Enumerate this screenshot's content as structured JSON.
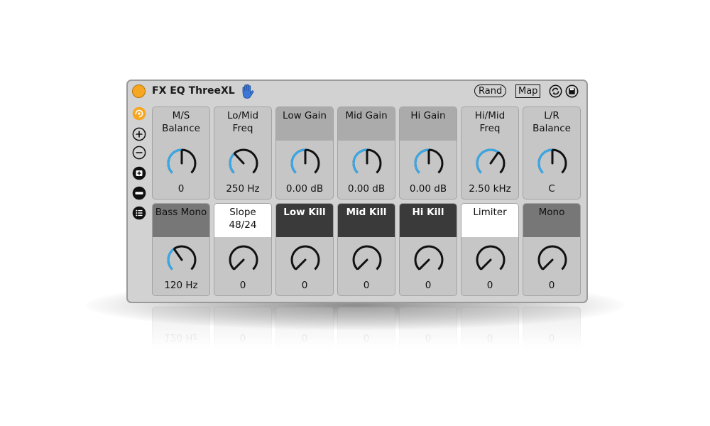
{
  "device": {
    "title": "FX EQ ThreeXL",
    "rand_label": "Rand",
    "map_label": "Map",
    "accent": "#f5a623",
    "knob_blue": "#37a8e8"
  },
  "row1": [
    {
      "label": "M/S Balance",
      "value": "0",
      "style": "plain",
      "level": 0.5
    },
    {
      "label": "Lo/Mid Freq",
      "value": "250 Hz",
      "style": "plain",
      "level": 0.34
    },
    {
      "label": "Low Gain",
      "value": "0.00 dB",
      "style": "gray",
      "level": 0.5
    },
    {
      "label": "Mid Gain",
      "value": "0.00 dB",
      "style": "gray",
      "level": 0.5
    },
    {
      "label": "Hi Gain",
      "value": "0.00 dB",
      "style": "gray",
      "level": 0.5
    },
    {
      "label": "Hi/Mid Freq",
      "value": "2.50 kHz",
      "style": "plain",
      "level": 0.63
    },
    {
      "label": "L/R Balance",
      "value": "C",
      "style": "plain",
      "level": 0.5
    }
  ],
  "row2": [
    {
      "label": "Bass Mono",
      "value": "120 Hz",
      "style": "dgray",
      "level": 0.37
    },
    {
      "label": "Slope 48/24",
      "value": "0",
      "style": "white",
      "level": 0
    },
    {
      "label": "Low Kill",
      "value": "0",
      "style": "dark",
      "level": 0
    },
    {
      "label": "Mid Kill",
      "value": "0",
      "style": "dark",
      "level": 0
    },
    {
      "label": "Hi Kill",
      "value": "0",
      "style": "dark",
      "level": 0
    },
    {
      "label": "Limiter",
      "value": "0",
      "style": "white",
      "level": 0
    },
    {
      "label": "Mono",
      "value": "0",
      "style": "dgray",
      "level": 0
    }
  ],
  "sidebar": [
    {
      "icon": "lfo-icon"
    },
    {
      "icon": "plus-icon"
    },
    {
      "icon": "minus-icon"
    },
    {
      "icon": "add-preset-icon"
    },
    {
      "icon": "remove-icon"
    },
    {
      "icon": "list-icon"
    }
  ]
}
